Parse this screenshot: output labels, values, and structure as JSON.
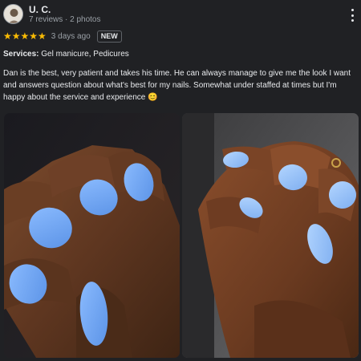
{
  "reviewer": {
    "name": "U. C.",
    "meta": "7 reviews · 2 photos"
  },
  "rating": {
    "stars": "★★★★★",
    "value": 5,
    "max": 5,
    "date": "3 days ago",
    "badge": "NEW",
    "star_color": "#fbbc04"
  },
  "services": {
    "label": "Services:",
    "value": "Gel manicure, Pedicures"
  },
  "review": {
    "text": "Dan is the best, very patient and takes his time. He can always manage to give me the look I want and answers question about what's best for my nails. Somewhat under staffed at times but I'm happy about the service and experience 😊"
  },
  "icons": {
    "more": "more-vert-icon",
    "avatar": "avatar-image"
  },
  "colors": {
    "background": "#202124",
    "text": "#e8eaed",
    "muted": "#9aa0a6",
    "nail_polish": "#6fa6f0"
  }
}
